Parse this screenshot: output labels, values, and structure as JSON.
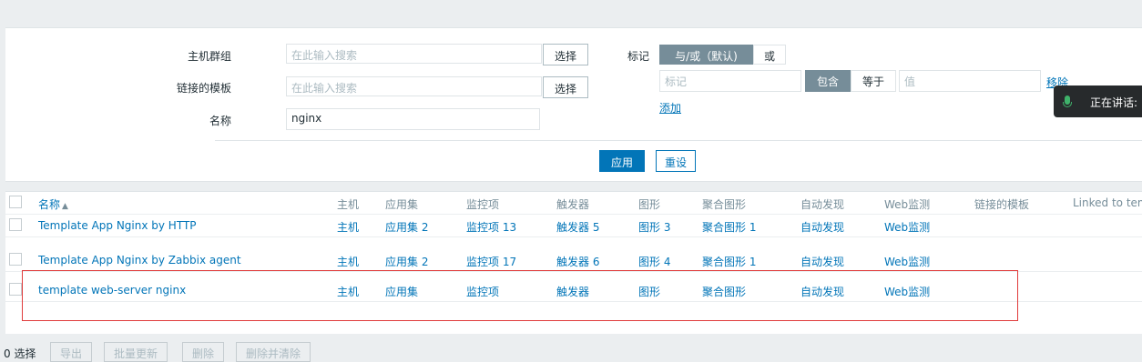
{
  "filter": {
    "host_group_label": "主机群组",
    "host_group_placeholder": "在此输入搜索",
    "linked_templates_label": "链接的模板",
    "linked_templates_placeholder": "在此输入搜索",
    "name_label": "名称",
    "name_value": "nginx",
    "select_label": "选择",
    "tags_label": "标记",
    "tag_and_or": "与/或（默认)",
    "tag_or": "或",
    "tag_placeholder": "标记",
    "tag_contains": "包含",
    "tag_equals": "等于",
    "tag_value_placeholder": "值",
    "tag_remove": "移除",
    "tag_add": "添加",
    "apply_label": "应用",
    "reset_label": "重设"
  },
  "tooltip": {
    "text": "正在讲话:"
  },
  "table": {
    "columns": [
      "名称",
      "主机",
      "应用集",
      "监控项",
      "触发器",
      "图形",
      "聚合图形",
      "自动发现",
      "Web监测",
      "链接的模板",
      "Linked to tem"
    ],
    "sort_indicator": "▲",
    "rows": [
      {
        "name": "Template App Nginx by HTTP",
        "hosts": "主机",
        "applications": "应用集 2",
        "items": "监控项 13",
        "triggers": "触发器 5",
        "graphs": "图形 3",
        "screens": "聚合图形 1",
        "discovery": "自动发现",
        "web": "Web监测"
      },
      {
        "name": "Template App Nginx by Zabbix agent",
        "hosts": "主机",
        "applications": "应用集 2",
        "items": "监控项 17",
        "triggers": "触发器 6",
        "graphs": "图形 4",
        "screens": "聚合图形 1",
        "discovery": "自动发现",
        "web": "Web监测"
      },
      {
        "name": "template web-server nginx",
        "hosts": "主机",
        "applications": "应用集",
        "items": "监控项",
        "triggers": "触发器",
        "graphs": "图形",
        "screens": "聚合图形",
        "discovery": "自动发现",
        "web": "Web监测"
      }
    ]
  },
  "footer": {
    "selected_count": "0 选择",
    "export": "导出",
    "mass_update": "批量更新",
    "delete": "删除",
    "delete_and_clear": "删除并清除"
  },
  "colors": {
    "link": "#0275b8",
    "highlight_border": "#e03b3b",
    "toggle_active": "#768d99"
  }
}
